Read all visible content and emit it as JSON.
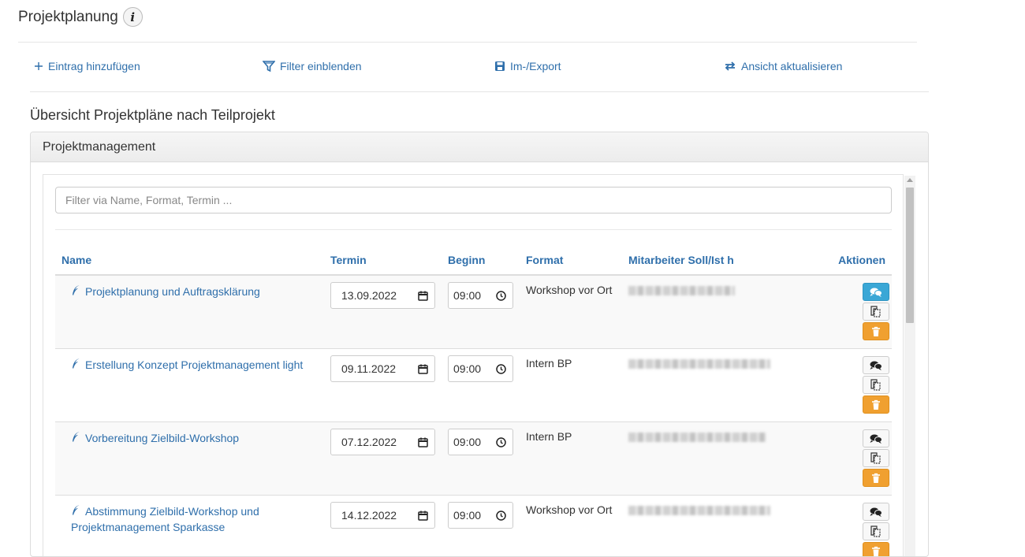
{
  "header": {
    "title": "Projektplanung",
    "info_icon": "info-icon"
  },
  "toolbar": {
    "add_label": "Eintrag hinzufügen",
    "filter_label": "Filter einblenden",
    "export_label": "Im-/Export",
    "refresh_label": "Ansicht aktualisieren"
  },
  "section_title": "Übersicht Projektpläne nach Teilprojekt",
  "panel": {
    "heading": "Projektmanagement",
    "filter_placeholder": "Filter via Name, Format, Termin ...",
    "columns": {
      "name": "Name",
      "termin": "Termin",
      "beginn": "Beginn",
      "format": "Format",
      "mitarbeiter": "Mitarbeiter Soll/Ist h",
      "aktionen": "Aktionen"
    },
    "rows": [
      {
        "name": "Projektplanung und Auftragsklärung",
        "termin": "13.09.2022",
        "beginn": "09:00",
        "format": "Workshop vor Ort",
        "mitarbeiter_blurred": true,
        "comment_active": true
      },
      {
        "name": "Erstellung Konzept Projektmanagement light",
        "termin": "09.11.2022",
        "beginn": "09:00",
        "format": "Intern BP",
        "mitarbeiter_blurred": true,
        "comment_active": false
      },
      {
        "name": "Vorbereitung Zielbild-Workshop",
        "termin": "07.12.2022",
        "beginn": "09:00",
        "format": "Intern BP",
        "mitarbeiter_blurred": true,
        "comment_active": false
      },
      {
        "name": "Abstimmung Zielbild-Workshop und Projektmanagement Sparkasse",
        "termin": "14.12.2022",
        "beginn": "09:00",
        "format": "Workshop vor Ort",
        "mitarbeiter_blurred": true,
        "comment_active": false
      }
    ]
  },
  "colors": {
    "link": "#2f6fab",
    "comment_active": "#3aa7d6",
    "delete": "#f0a030"
  }
}
